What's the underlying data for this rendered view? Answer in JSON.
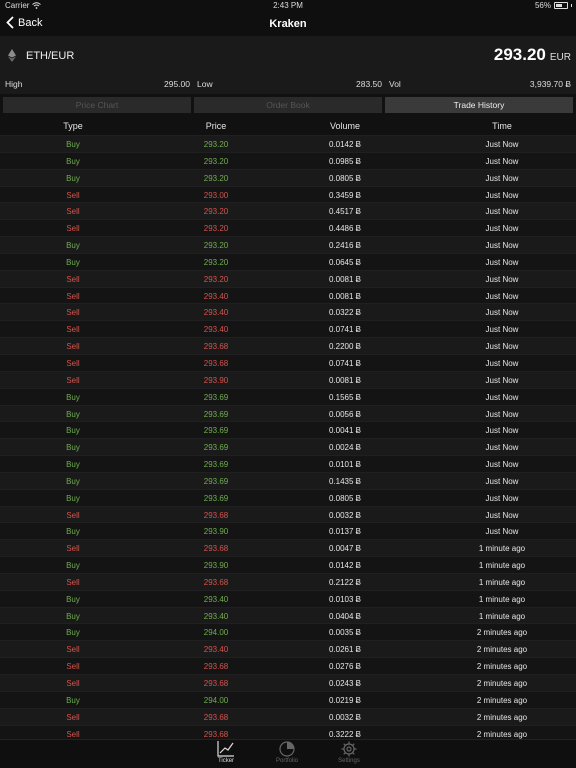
{
  "status": {
    "carrier": "Carrier",
    "time": "2:43 PM",
    "battery": "56%",
    "battery_level": 0.56
  },
  "nav": {
    "back": "Back",
    "title": "Kraken"
  },
  "ticker": {
    "pair": "ETH/EUR",
    "price": "293.20",
    "currency": "EUR",
    "high_label": "High",
    "high": "295.00",
    "low_label": "Low",
    "low": "283.50",
    "vol_label": "Vol",
    "vol": "3,939.70 Ƀ"
  },
  "segments": [
    "Price Chart",
    "Order Book",
    "Trade History"
  ],
  "table": {
    "headers": [
      "Type",
      "Price",
      "Volume",
      "Time"
    ],
    "rows": [
      [
        "Buy",
        "293.20",
        "0.0142 Ƀ",
        "Just Now"
      ],
      [
        "Buy",
        "293.20",
        "0.0985 Ƀ",
        "Just Now"
      ],
      [
        "Buy",
        "293.20",
        "0.0805 Ƀ",
        "Just Now"
      ],
      [
        "Sell",
        "293.00",
        "0.3459 Ƀ",
        "Just Now"
      ],
      [
        "Sell",
        "293.20",
        "0.4517 Ƀ",
        "Just Now"
      ],
      [
        "Sell",
        "293.20",
        "0.4486 Ƀ",
        "Just Now"
      ],
      [
        "Buy",
        "293.20",
        "0.2416 Ƀ",
        "Just Now"
      ],
      [
        "Buy",
        "293.20",
        "0.0645 Ƀ",
        "Just Now"
      ],
      [
        "Sell",
        "293.20",
        "0.0081 Ƀ",
        "Just Now"
      ],
      [
        "Sell",
        "293.40",
        "0.0081 Ƀ",
        "Just Now"
      ],
      [
        "Sell",
        "293.40",
        "0.0322 Ƀ",
        "Just Now"
      ],
      [
        "Sell",
        "293.40",
        "0.0741 Ƀ",
        "Just Now"
      ],
      [
        "Sell",
        "293.68",
        "0.2200 Ƀ",
        "Just Now"
      ],
      [
        "Sell",
        "293.68",
        "0.0741 Ƀ",
        "Just Now"
      ],
      [
        "Sell",
        "293.90",
        "0.0081 Ƀ",
        "Just Now"
      ],
      [
        "Buy",
        "293.69",
        "0.1565 Ƀ",
        "Just Now"
      ],
      [
        "Buy",
        "293.69",
        "0.0056 Ƀ",
        "Just Now"
      ],
      [
        "Buy",
        "293.69",
        "0.0041 Ƀ",
        "Just Now"
      ],
      [
        "Buy",
        "293.69",
        "0.0024 Ƀ",
        "Just Now"
      ],
      [
        "Buy",
        "293.69",
        "0.0101 Ƀ",
        "Just Now"
      ],
      [
        "Buy",
        "293.69",
        "0.1435 Ƀ",
        "Just Now"
      ],
      [
        "Buy",
        "293.69",
        "0.0805 Ƀ",
        "Just Now"
      ],
      [
        "Sell",
        "293.68",
        "0.0032 Ƀ",
        "Just Now"
      ],
      [
        "Buy",
        "293.90",
        "0.0137 Ƀ",
        "Just Now"
      ],
      [
        "Sell",
        "293.68",
        "0.0047 Ƀ",
        "1 minute ago"
      ],
      [
        "Buy",
        "293.90",
        "0.0142 Ƀ",
        "1 minute ago"
      ],
      [
        "Sell",
        "293.68",
        "0.2122 Ƀ",
        "1 minute ago"
      ],
      [
        "Buy",
        "293.40",
        "0.0103 Ƀ",
        "1 minute ago"
      ],
      [
        "Buy",
        "293.40",
        "0.0404 Ƀ",
        "1 minute ago"
      ],
      [
        "Buy",
        "294.00",
        "0.0035 Ƀ",
        "2 minutes ago"
      ],
      [
        "Sell",
        "293.40",
        "0.0261 Ƀ",
        "2 minutes ago"
      ],
      [
        "Sell",
        "293.68",
        "0.0276 Ƀ",
        "2 minutes ago"
      ],
      [
        "Sell",
        "293.68",
        "0.0243 Ƀ",
        "2 minutes ago"
      ],
      [
        "Buy",
        "294.00",
        "0.0219 Ƀ",
        "2 minutes ago"
      ],
      [
        "Sell",
        "293.68",
        "0.0032 Ƀ",
        "2 minutes ago"
      ],
      [
        "Sell",
        "293.68",
        "0.3222 Ƀ",
        "2 minutes ago"
      ]
    ]
  },
  "tabs": [
    {
      "label": "Ticker",
      "icon": "chart-line-icon",
      "active": true
    },
    {
      "label": "Portfolio",
      "icon": "pie-chart-icon",
      "active": false
    },
    {
      "label": "Settings",
      "icon": "gear-icon",
      "active": false
    }
  ],
  "colors": {
    "buy": "#6fae4f",
    "sell": "#d4544b",
    "background": "#111112"
  }
}
